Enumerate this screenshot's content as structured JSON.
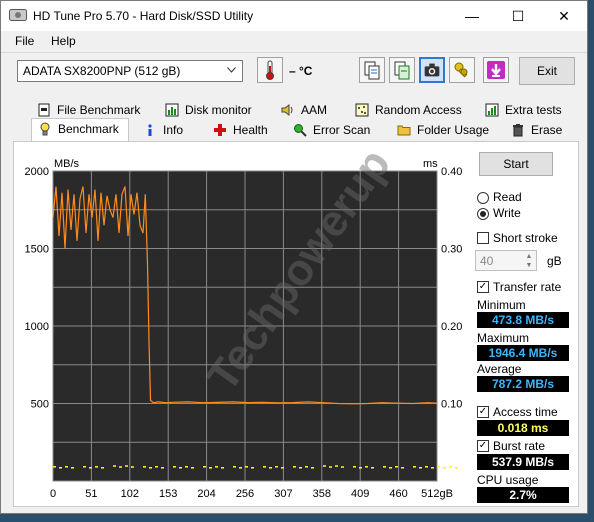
{
  "window": {
    "title": "HD Tune Pro 5.70 - Hard Disk/SSD Utility",
    "minimize": "—",
    "maximize": "☐",
    "close": "✕"
  },
  "menu": {
    "file": "File",
    "help": "Help"
  },
  "toolbar": {
    "drive": "ADATA SX8200PNP (512 gB)",
    "temperature": "– °C",
    "exit_label": "Exit",
    "icons": [
      "copy-info-icon",
      "save-text-icon",
      "screenshot-camera-icon",
      "options-keys-icon",
      "download-icon"
    ]
  },
  "tabs_row1": [
    {
      "label": "File Benchmark",
      "icon": "file-benchmark-icon"
    },
    {
      "label": "Disk monitor",
      "icon": "disk-monitor-icon"
    },
    {
      "label": "AAM",
      "icon": "speaker-icon"
    },
    {
      "label": "Random Access",
      "icon": "random-access-icon"
    },
    {
      "label": "Extra tests",
      "icon": "extra-tests-icon"
    }
  ],
  "tabs_row2": [
    {
      "label": "Benchmark",
      "icon": "benchmark-bulb-icon",
      "active": true
    },
    {
      "label": "Info",
      "icon": "info-icon"
    },
    {
      "label": "Health",
      "icon": "health-cross-icon"
    },
    {
      "label": "Error Scan",
      "icon": "error-scan-icon"
    },
    {
      "label": "Folder Usage",
      "icon": "folder-icon"
    },
    {
      "label": "Erase",
      "icon": "trash-icon"
    }
  ],
  "controls": {
    "start_label": "Start",
    "read_label": "Read",
    "write_label": "Write",
    "mode": "write",
    "short_stroke_label": "Short stroke",
    "short_stroke_checked": false,
    "short_stroke_value": "40",
    "short_stroke_unit": "gB",
    "transfer_rate_label": "Transfer rate",
    "transfer_rate_checked": true,
    "minimum_label": "Minimum",
    "minimum_value": "473.8 MB/s",
    "maximum_label": "Maximum",
    "maximum_value": "1946.4 MB/s",
    "average_label": "Average",
    "average_value": "787.2 MB/s",
    "access_time_label": "Access time",
    "access_time_checked": true,
    "access_time_value": "0.018 ms",
    "burst_rate_label": "Burst rate",
    "burst_rate_checked": true,
    "burst_rate_value": "537.9 MB/s",
    "cpu_usage_label": "CPU usage",
    "cpu_usage_value": "2.7%"
  },
  "chart_data": {
    "type": "line",
    "ylabel_left": "MB/s",
    "ylabel_right": "ms",
    "y_left_ticks": [
      "2000",
      "1500",
      "1000",
      "500"
    ],
    "y_left_lim": [
      0,
      2000
    ],
    "y_right_ticks": [
      "0.40",
      "0.30",
      "0.20",
      "0.10"
    ],
    "y_right_lim": [
      0,
      0.4
    ],
    "x_ticks": [
      "0",
      "51",
      "102",
      "153",
      "204",
      "256",
      "307",
      "358",
      "409",
      "460",
      "512gB"
    ],
    "x_lim": [
      0,
      512
    ],
    "grid": true,
    "watermark": "Techpowerup",
    "series": [
      {
        "color": "#ff8c1a",
        "x": [
          0,
          4,
          8,
          12,
          16,
          20,
          24,
          28,
          32,
          36,
          40,
          44,
          48,
          52,
          56,
          60,
          64,
          68,
          72,
          76,
          80,
          84,
          88,
          92,
          96,
          100,
          104,
          108,
          112,
          116,
          120,
          123,
          126,
          128,
          130,
          134,
          140,
          150,
          160,
          180,
          200,
          220,
          240,
          260,
          280,
          300,
          320,
          340,
          360,
          380,
          400,
          420,
          440,
          460,
          480,
          500,
          512
        ],
        "y": [
          1700,
          1900,
          1580,
          1860,
          1500,
          1880,
          1620,
          1850,
          1550,
          1820,
          1900,
          1600,
          1850,
          1700,
          1880,
          1550,
          1860,
          1650,
          1840,
          1750,
          1700,
          1850,
          1600,
          1850,
          1900,
          1580,
          1850,
          1720,
          1860,
          1650,
          1600,
          1850,
          1400,
          900,
          520,
          505,
          510,
          505,
          508,
          510,
          505,
          507,
          510,
          506,
          508,
          504,
          506,
          510,
          505,
          500,
          498,
          500,
          505,
          502,
          500,
          505,
          502
        ]
      },
      {
        "color": "#ffff00",
        "x": [
          0,
          40,
          80,
          120,
          160,
          200,
          240,
          280,
          320,
          360,
          400,
          440,
          480,
          512
        ],
        "y": [
          0.018,
          0.018,
          0.019,
          0.018,
          0.018,
          0.018,
          0.018,
          0.018,
          0.018,
          0.019,
          0.018,
          0.018,
          0.018,
          0.018
        ]
      }
    ]
  }
}
